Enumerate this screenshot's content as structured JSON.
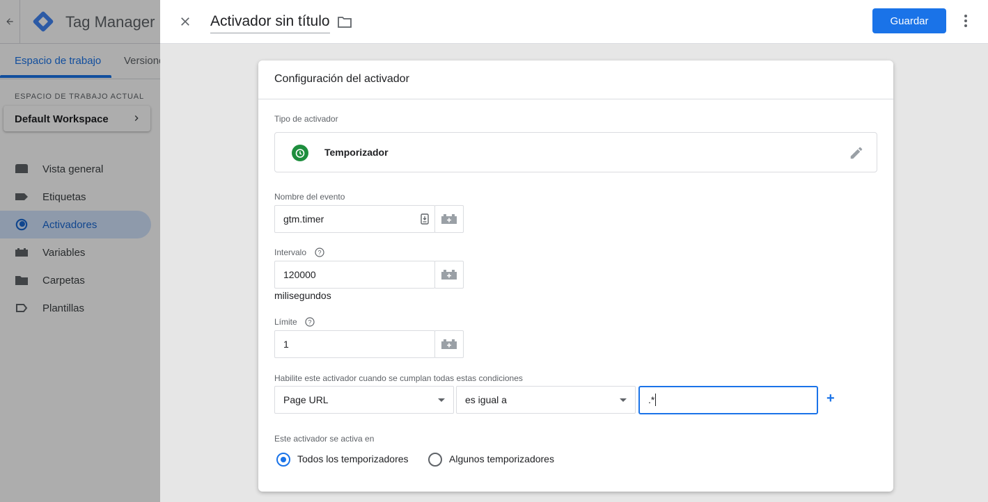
{
  "shell": {
    "app_name": "Tag Manager",
    "tabs": [
      {
        "label": "Espacio de trabajo",
        "active": true
      },
      {
        "label": "Versiones",
        "active": false
      }
    ],
    "workspace_label": "ESPACIO DE TRABAJO ACTUAL",
    "workspace_name": "Default Workspace",
    "nav": [
      {
        "label": "Vista general",
        "icon": "overview-icon",
        "active": false
      },
      {
        "label": "Etiquetas",
        "icon": "tag-icon",
        "active": false
      },
      {
        "label": "Activadores",
        "icon": "trigger-icon",
        "active": true
      },
      {
        "label": "Variables",
        "icon": "variables-icon",
        "active": false
      },
      {
        "label": "Carpetas",
        "icon": "folder-icon",
        "active": false
      },
      {
        "label": "Plantillas",
        "icon": "template-icon",
        "active": false
      }
    ]
  },
  "header": {
    "title": "Activador sin título",
    "save_label": "Guardar"
  },
  "card": {
    "title": "Configuración del activador",
    "trigger_type_label": "Tipo de activador",
    "trigger_type_value": "Temporizador",
    "event_name_label": "Nombre del evento",
    "event_name_value": "gtm.timer",
    "interval_label": "Intervalo",
    "interval_value": "120000",
    "interval_unit": "milisegundos",
    "limit_label": "Límite",
    "limit_value": "1",
    "conditions_label": "Habilite este activador cuando se cumplan todas estas condiciones",
    "condition": {
      "variable": "Page URL",
      "operator": "es igual a",
      "value": ".*"
    },
    "add_label": "+",
    "fires_on_label": "Este activador se activa en",
    "fires_on_options": [
      {
        "label": "Todos los temporizadores",
        "checked": true
      },
      {
        "label": "Algunos temporizadores",
        "checked": false
      }
    ]
  },
  "colors": {
    "accent": "#1a73e8",
    "timer_icon": "#1e8e3e"
  }
}
